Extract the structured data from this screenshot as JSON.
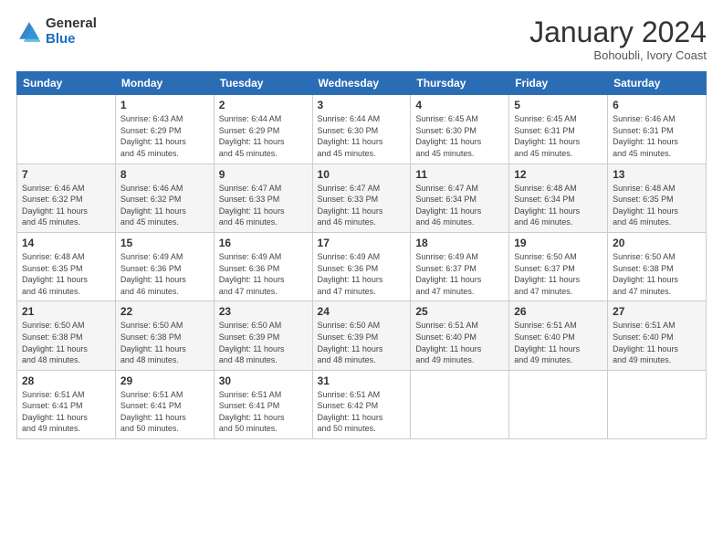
{
  "logo": {
    "general": "General",
    "blue": "Blue"
  },
  "header": {
    "month": "January 2024",
    "location": "Bohoubli, Ivory Coast"
  },
  "weekdays": [
    "Sunday",
    "Monday",
    "Tuesday",
    "Wednesday",
    "Thursday",
    "Friday",
    "Saturday"
  ],
  "weeks": [
    [
      {
        "day": "",
        "info": ""
      },
      {
        "day": "1",
        "info": "Sunrise: 6:43 AM\nSunset: 6:29 PM\nDaylight: 11 hours\nand 45 minutes."
      },
      {
        "day": "2",
        "info": "Sunrise: 6:44 AM\nSunset: 6:29 PM\nDaylight: 11 hours\nand 45 minutes."
      },
      {
        "day": "3",
        "info": "Sunrise: 6:44 AM\nSunset: 6:30 PM\nDaylight: 11 hours\nand 45 minutes."
      },
      {
        "day": "4",
        "info": "Sunrise: 6:45 AM\nSunset: 6:30 PM\nDaylight: 11 hours\nand 45 minutes."
      },
      {
        "day": "5",
        "info": "Sunrise: 6:45 AM\nSunset: 6:31 PM\nDaylight: 11 hours\nand 45 minutes."
      },
      {
        "day": "6",
        "info": "Sunrise: 6:46 AM\nSunset: 6:31 PM\nDaylight: 11 hours\nand 45 minutes."
      }
    ],
    [
      {
        "day": "7",
        "info": "Sunrise: 6:46 AM\nSunset: 6:32 PM\nDaylight: 11 hours\nand 45 minutes."
      },
      {
        "day": "8",
        "info": "Sunrise: 6:46 AM\nSunset: 6:32 PM\nDaylight: 11 hours\nand 45 minutes."
      },
      {
        "day": "9",
        "info": "Sunrise: 6:47 AM\nSunset: 6:33 PM\nDaylight: 11 hours\nand 46 minutes."
      },
      {
        "day": "10",
        "info": "Sunrise: 6:47 AM\nSunset: 6:33 PM\nDaylight: 11 hours\nand 46 minutes."
      },
      {
        "day": "11",
        "info": "Sunrise: 6:47 AM\nSunset: 6:34 PM\nDaylight: 11 hours\nand 46 minutes."
      },
      {
        "day": "12",
        "info": "Sunrise: 6:48 AM\nSunset: 6:34 PM\nDaylight: 11 hours\nand 46 minutes."
      },
      {
        "day": "13",
        "info": "Sunrise: 6:48 AM\nSunset: 6:35 PM\nDaylight: 11 hours\nand 46 minutes."
      }
    ],
    [
      {
        "day": "14",
        "info": "Sunrise: 6:48 AM\nSunset: 6:35 PM\nDaylight: 11 hours\nand 46 minutes."
      },
      {
        "day": "15",
        "info": "Sunrise: 6:49 AM\nSunset: 6:36 PM\nDaylight: 11 hours\nand 46 minutes."
      },
      {
        "day": "16",
        "info": "Sunrise: 6:49 AM\nSunset: 6:36 PM\nDaylight: 11 hours\nand 47 minutes."
      },
      {
        "day": "17",
        "info": "Sunrise: 6:49 AM\nSunset: 6:36 PM\nDaylight: 11 hours\nand 47 minutes."
      },
      {
        "day": "18",
        "info": "Sunrise: 6:49 AM\nSunset: 6:37 PM\nDaylight: 11 hours\nand 47 minutes."
      },
      {
        "day": "19",
        "info": "Sunrise: 6:50 AM\nSunset: 6:37 PM\nDaylight: 11 hours\nand 47 minutes."
      },
      {
        "day": "20",
        "info": "Sunrise: 6:50 AM\nSunset: 6:38 PM\nDaylight: 11 hours\nand 47 minutes."
      }
    ],
    [
      {
        "day": "21",
        "info": "Sunrise: 6:50 AM\nSunset: 6:38 PM\nDaylight: 11 hours\nand 48 minutes."
      },
      {
        "day": "22",
        "info": "Sunrise: 6:50 AM\nSunset: 6:38 PM\nDaylight: 11 hours\nand 48 minutes."
      },
      {
        "day": "23",
        "info": "Sunrise: 6:50 AM\nSunset: 6:39 PM\nDaylight: 11 hours\nand 48 minutes."
      },
      {
        "day": "24",
        "info": "Sunrise: 6:50 AM\nSunset: 6:39 PM\nDaylight: 11 hours\nand 48 minutes."
      },
      {
        "day": "25",
        "info": "Sunrise: 6:51 AM\nSunset: 6:40 PM\nDaylight: 11 hours\nand 49 minutes."
      },
      {
        "day": "26",
        "info": "Sunrise: 6:51 AM\nSunset: 6:40 PM\nDaylight: 11 hours\nand 49 minutes."
      },
      {
        "day": "27",
        "info": "Sunrise: 6:51 AM\nSunset: 6:40 PM\nDaylight: 11 hours\nand 49 minutes."
      }
    ],
    [
      {
        "day": "28",
        "info": "Sunrise: 6:51 AM\nSunset: 6:41 PM\nDaylight: 11 hours\nand 49 minutes."
      },
      {
        "day": "29",
        "info": "Sunrise: 6:51 AM\nSunset: 6:41 PM\nDaylight: 11 hours\nand 50 minutes."
      },
      {
        "day": "30",
        "info": "Sunrise: 6:51 AM\nSunset: 6:41 PM\nDaylight: 11 hours\nand 50 minutes."
      },
      {
        "day": "31",
        "info": "Sunrise: 6:51 AM\nSunset: 6:42 PM\nDaylight: 11 hours\nand 50 minutes."
      },
      {
        "day": "",
        "info": ""
      },
      {
        "day": "",
        "info": ""
      },
      {
        "day": "",
        "info": ""
      }
    ]
  ]
}
